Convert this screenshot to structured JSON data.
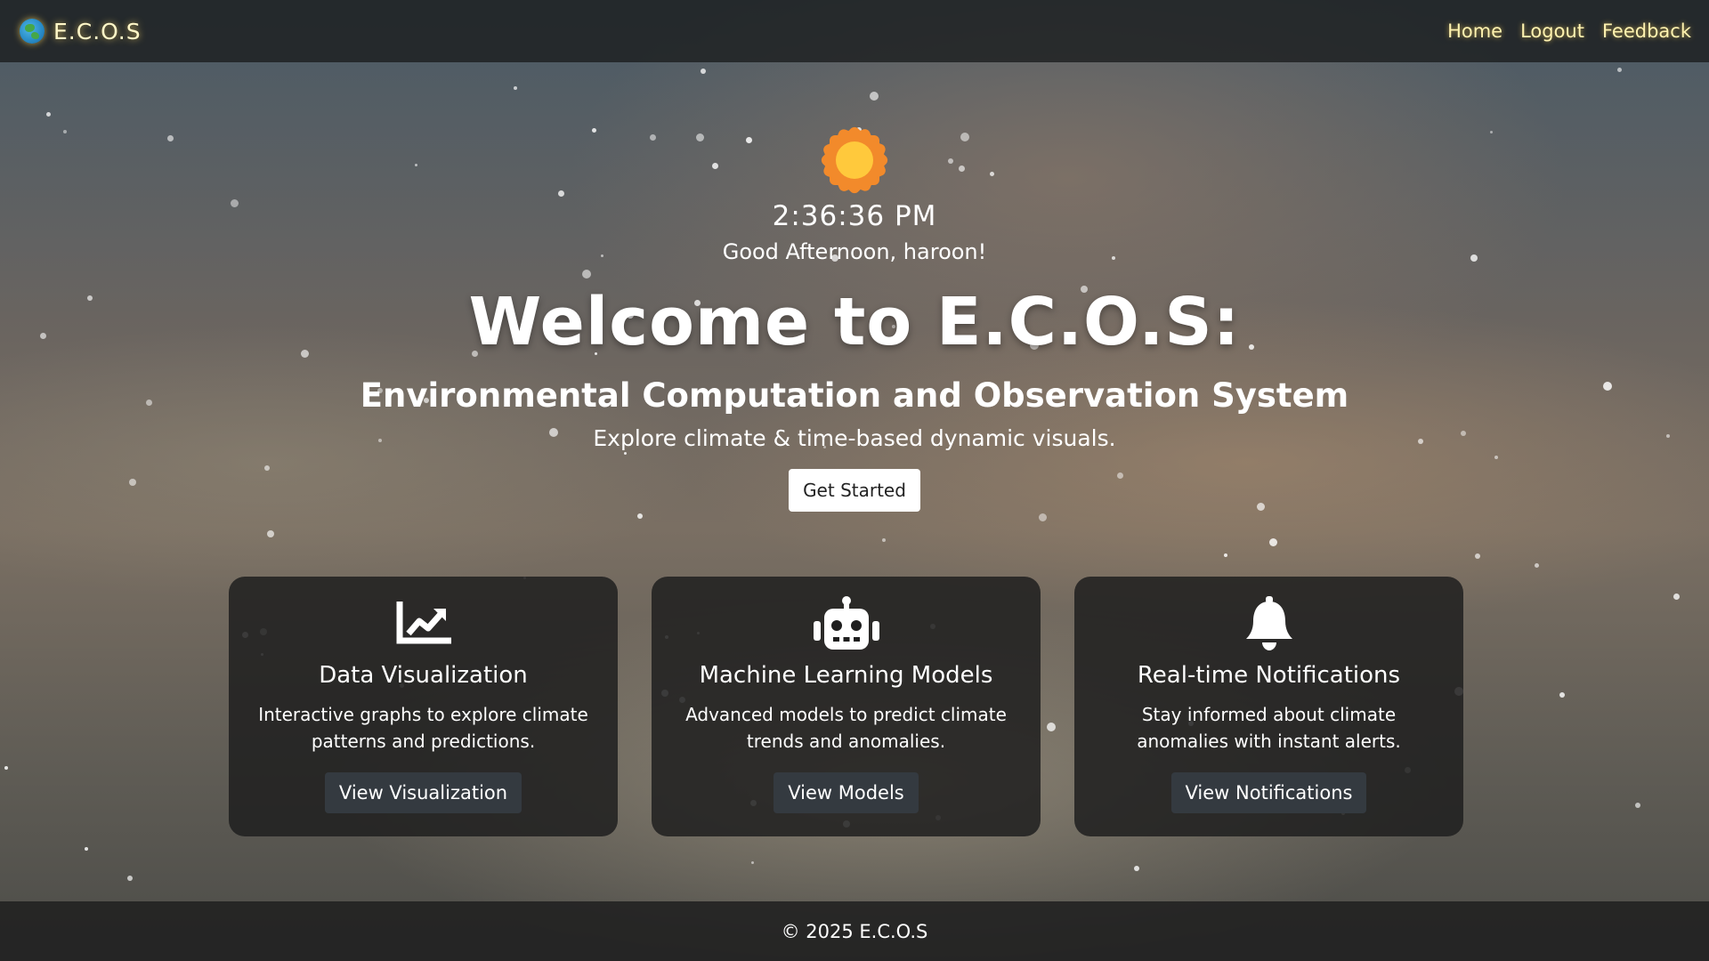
{
  "navbar": {
    "brand": "E.C.O.S",
    "links": [
      "Home",
      "Logout",
      "Feedback"
    ]
  },
  "hero": {
    "time": "2:36:36 PM",
    "greeting": "Good Afternoon, haroon!",
    "title": "Welcome to E.C.O.S:",
    "subtitle": "Environmental Computation and Observation System",
    "tagline": "Explore climate & time-based dynamic visuals.",
    "cta_label": "Get Started"
  },
  "cards": [
    {
      "icon": "chart-line-icon",
      "title": "Data Visualization",
      "description": "Interactive graphs to explore climate patterns and predictions.",
      "button": "View Visualization"
    },
    {
      "icon": "robot-icon",
      "title": "Machine Learning Models",
      "description": "Advanced models to predict climate trends and anomalies.",
      "button": "View Models"
    },
    {
      "icon": "bell-icon",
      "title": "Real-time Notifications",
      "description": "Stay informed about climate anomalies with instant alerts.",
      "button": "View Notifications"
    }
  ],
  "footer": {
    "copyright": "© 2025 E.C.O.S"
  },
  "colors": {
    "brand_glow": "#fff3b0",
    "card_bg": "#1e1e1e",
    "card_button": "#343a40",
    "sun_core": "#ffc93c",
    "sun_rays": "#f28a2b"
  }
}
